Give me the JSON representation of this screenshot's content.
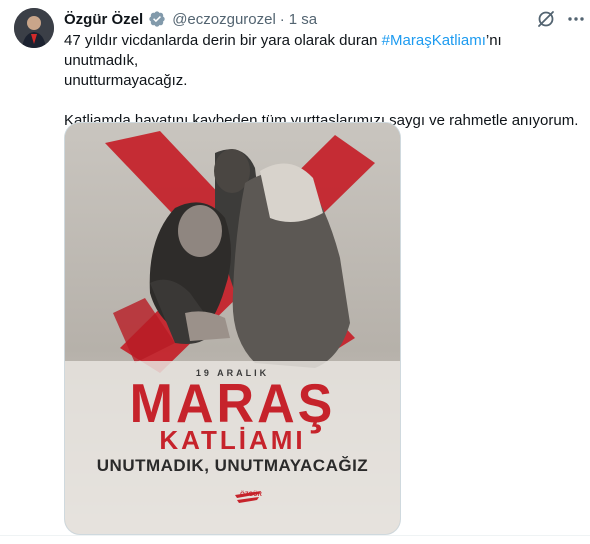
{
  "tweet": {
    "author_name": "Özgür Özel",
    "handle": "@eczozgurozel",
    "separator": "·",
    "time": "1 sa",
    "text_line1_prefix": "47 yıldır vicdanlarda derin bir yara olarak duran ",
    "hashtag": "#MaraşKatliamı",
    "text_line1_suffix": "’nı unutmadık,",
    "text_line2": "unutturmayacağız.",
    "text_para2": "Katliamda hayatını kaybeden tüm yurttaşlarımızı saygı ve rahmetle anıyorum."
  },
  "poster": {
    "date": "19 ARALIK",
    "title_main": "MARAŞ",
    "title_sub": "KATLİAMI",
    "slogan": "UNUTMADIK, UNUTMAYACAĞIZ",
    "logo_text": "ÖZGÜR"
  },
  "icons": {
    "verified": "verified-badge-icon",
    "grok": "grok-icon",
    "more": "more-icon"
  },
  "colors": {
    "link": "#1d9bf0",
    "secondary_text": "#536471",
    "poster_red": "#c6232b"
  }
}
